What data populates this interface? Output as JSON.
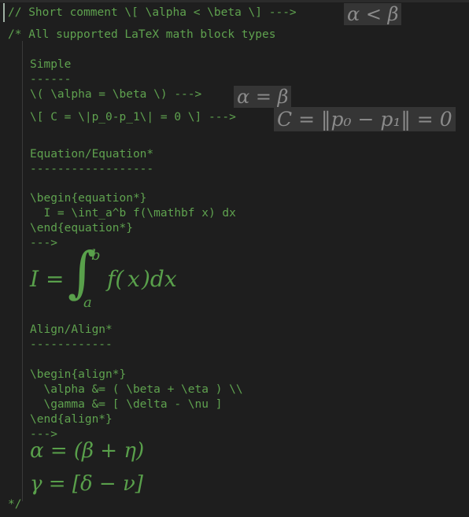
{
  "editor": {
    "comment_line": "// Short comment \\[ \\alpha < \\beta \\] --->",
    "comment_math": "α < β",
    "block_open": "/* All supported LaTeX math block types",
    "simple": {
      "title": "Simple",
      "underline": "------",
      "line1": "\\( \\alpha = \\beta \\) --->",
      "line1_math": "α = β",
      "line2": "\\[ C = \\|p_0-p_1\\| = 0 \\] --->",
      "line2_math": "C = ‖p₀ − p₁‖ = 0"
    },
    "equation": {
      "title": "Equation/Equation*",
      "underline": "------------------",
      "begin": "\\begin{equation*}",
      "body": "  I = \\int_a^b f(\\mathbf x) dx",
      "end": "\\end{equation*}",
      "arrow": "--->",
      "render_lhs": "I =",
      "render_int": "∫",
      "render_upper": "b",
      "render_lower": "a",
      "render_f": "f(",
      "render_x": "x",
      "render_close": ")dx"
    },
    "align": {
      "title": "Align/Align*",
      "underline": "------------",
      "begin": "\\begin{align*}",
      "line1": "  \\alpha &= ( \\beta + \\eta ) \\\\",
      "line2": "  \\gamma &= [ \\delta - \\nu ]",
      "end": "\\end{align*}",
      "arrow": "--->",
      "render1": "α = (β + η)",
      "render2": "γ = [δ − ν]"
    },
    "block_close": "*/"
  }
}
